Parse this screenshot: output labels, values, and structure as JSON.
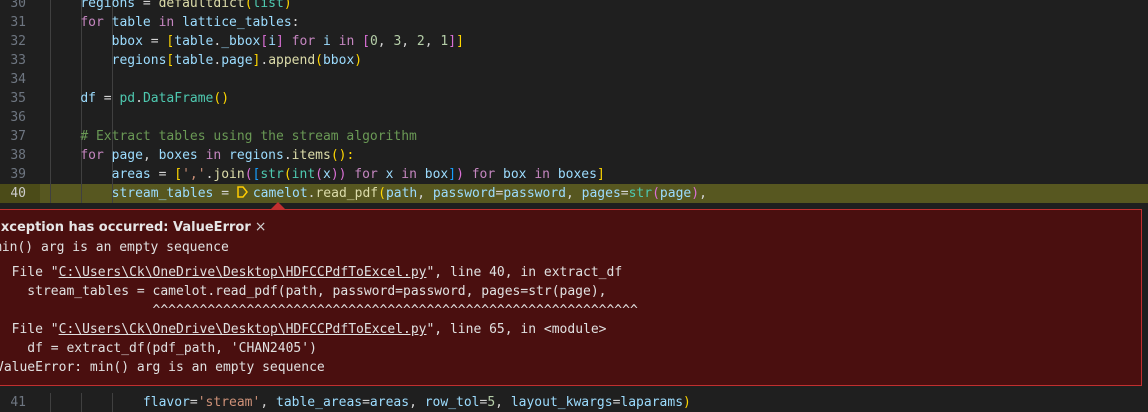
{
  "editor": {
    "lines": [
      {
        "num": "30",
        "segments": [
          {
            "t": "    "
          },
          {
            "t": "regions",
            "c": "var"
          },
          {
            "t": " = "
          },
          {
            "t": "defaultdict",
            "c": "fn"
          },
          {
            "t": "(",
            "c": "br1"
          },
          {
            "t": "list",
            "c": "cls"
          },
          {
            "t": ")",
            "c": "br1"
          }
        ]
      },
      {
        "num": "31",
        "segments": [
          {
            "t": "    "
          },
          {
            "t": "for",
            "c": "kw"
          },
          {
            "t": " "
          },
          {
            "t": "table",
            "c": "var"
          },
          {
            "t": " "
          },
          {
            "t": "in",
            "c": "kw"
          },
          {
            "t": " "
          },
          {
            "t": "lattice_tables",
            "c": "var"
          },
          {
            "t": ":"
          }
        ]
      },
      {
        "num": "32",
        "segments": [
          {
            "t": "        "
          },
          {
            "t": "bbox",
            "c": "var"
          },
          {
            "t": " = "
          },
          {
            "t": "[",
            "c": "br1"
          },
          {
            "t": "table",
            "c": "var"
          },
          {
            "t": "."
          },
          {
            "t": "_bbox",
            "c": "var"
          },
          {
            "t": "[",
            "c": "br2"
          },
          {
            "t": "i",
            "c": "var"
          },
          {
            "t": "]",
            "c": "br2"
          },
          {
            "t": " "
          },
          {
            "t": "for",
            "c": "kw"
          },
          {
            "t": " "
          },
          {
            "t": "i",
            "c": "var"
          },
          {
            "t": " "
          },
          {
            "t": "in",
            "c": "kw"
          },
          {
            "t": " "
          },
          {
            "t": "[",
            "c": "br2"
          },
          {
            "t": "0",
            "c": "num"
          },
          {
            "t": ", "
          },
          {
            "t": "3",
            "c": "num"
          },
          {
            "t": ", "
          },
          {
            "t": "2",
            "c": "num"
          },
          {
            "t": ", "
          },
          {
            "t": "1",
            "c": "num"
          },
          {
            "t": "]",
            "c": "br2"
          },
          {
            "t": "]",
            "c": "br1"
          }
        ]
      },
      {
        "num": "33",
        "segments": [
          {
            "t": "        "
          },
          {
            "t": "regions",
            "c": "var"
          },
          {
            "t": "[",
            "c": "br1"
          },
          {
            "t": "table",
            "c": "var"
          },
          {
            "t": "."
          },
          {
            "t": "page",
            "c": "var"
          },
          {
            "t": "]",
            "c": "br1"
          },
          {
            "t": "."
          },
          {
            "t": "append",
            "c": "fn"
          },
          {
            "t": "(",
            "c": "br1"
          },
          {
            "t": "bbox",
            "c": "var"
          },
          {
            "t": ")",
            "c": "br1"
          }
        ]
      },
      {
        "num": "34",
        "segments": []
      },
      {
        "num": "35",
        "segments": [
          {
            "t": "    "
          },
          {
            "t": "df",
            "c": "var"
          },
          {
            "t": " = "
          },
          {
            "t": "pd",
            "c": "cls"
          },
          {
            "t": "."
          },
          {
            "t": "DataFrame",
            "c": "cls"
          },
          {
            "t": "()",
            "c": "br1"
          }
        ]
      },
      {
        "num": "36",
        "segments": []
      },
      {
        "num": "37",
        "segments": [
          {
            "t": "    "
          },
          {
            "t": "# Extract tables using the stream algorithm",
            "c": "cmt"
          }
        ]
      },
      {
        "num": "38",
        "segments": [
          {
            "t": "    "
          },
          {
            "t": "for",
            "c": "kw"
          },
          {
            "t": " "
          },
          {
            "t": "page",
            "c": "var"
          },
          {
            "t": ", "
          },
          {
            "t": "boxes",
            "c": "var"
          },
          {
            "t": " "
          },
          {
            "t": "in",
            "c": "kw"
          },
          {
            "t": " "
          },
          {
            "t": "regions",
            "c": "var"
          },
          {
            "t": "."
          },
          {
            "t": "items",
            "c": "fn"
          },
          {
            "t": "():",
            "c": "br1"
          }
        ]
      },
      {
        "num": "39",
        "segments": [
          {
            "t": "        "
          },
          {
            "t": "areas",
            "c": "var"
          },
          {
            "t": " = "
          },
          {
            "t": "[",
            "c": "br1"
          },
          {
            "t": "','",
            "c": "str"
          },
          {
            "t": "."
          },
          {
            "t": "join",
            "c": "fn"
          },
          {
            "t": "(",
            "c": "br2"
          },
          {
            "t": "[",
            "c": "br3"
          },
          {
            "t": "str",
            "c": "cls"
          },
          {
            "t": "(",
            "c": "br1"
          },
          {
            "t": "int",
            "c": "cls"
          },
          {
            "t": "(",
            "c": "br2"
          },
          {
            "t": "x",
            "c": "var"
          },
          {
            "t": "))",
            "c": "br2"
          },
          {
            "t": " "
          },
          {
            "t": "for",
            "c": "kw"
          },
          {
            "t": " "
          },
          {
            "t": "x",
            "c": "var"
          },
          {
            "t": " "
          },
          {
            "t": "in",
            "c": "kw"
          },
          {
            "t": " "
          },
          {
            "t": "box",
            "c": "var"
          },
          {
            "t": "]",
            "c": "br3"
          },
          {
            "t": ")",
            "c": "br2"
          },
          {
            "t": " "
          },
          {
            "t": "for",
            "c": "kw"
          },
          {
            "t": " "
          },
          {
            "t": "box",
            "c": "var"
          },
          {
            "t": " "
          },
          {
            "t": "in",
            "c": "kw"
          },
          {
            "t": " "
          },
          {
            "t": "boxes",
            "c": "var"
          },
          {
            "t": "]",
            "c": "br1"
          }
        ]
      },
      {
        "num": "40",
        "current": true,
        "segments": [
          {
            "t": "        "
          },
          {
            "t": "stream_tables",
            "c": "var"
          },
          {
            "t": " = "
          },
          {
            "bp": true
          },
          {
            "t": "camelot",
            "c": "var"
          },
          {
            "t": "."
          },
          {
            "t": "read_pdf",
            "c": "fn"
          },
          {
            "t": "(",
            "c": "br1"
          },
          {
            "t": "path",
            "c": "var"
          },
          {
            "t": ", "
          },
          {
            "t": "password",
            "c": "var"
          },
          {
            "t": "="
          },
          {
            "t": "password",
            "c": "var"
          },
          {
            "t": ", "
          },
          {
            "t": "pages",
            "c": "var"
          },
          {
            "t": "="
          },
          {
            "t": "str",
            "c": "cls"
          },
          {
            "t": "(",
            "c": "br2"
          },
          {
            "t": "page",
            "c": "var"
          },
          {
            "t": ")",
            "c": "br2"
          },
          {
            "t": ","
          }
        ]
      },
      {
        "num": "41",
        "segments": [
          {
            "t": "            "
          },
          {
            "t": "flavor",
            "c": "var"
          },
          {
            "t": "="
          },
          {
            "t": "'stream'",
            "c": "str"
          },
          {
            "t": ", "
          },
          {
            "t": "table_areas",
            "c": "var"
          },
          {
            "t": "="
          },
          {
            "t": "areas",
            "c": "var"
          },
          {
            "t": ", "
          },
          {
            "t": "row_tol",
            "c": "var"
          },
          {
            "t": "="
          },
          {
            "t": "5",
            "c": "num"
          },
          {
            "t": ", "
          },
          {
            "t": "layout_kwargs",
            "c": "var"
          },
          {
            "t": "="
          },
          {
            "t": "laparams",
            "c": "var"
          },
          {
            "t": ")",
            "c": "br1"
          }
        ]
      }
    ]
  },
  "exception": {
    "title": "Exception has occurred: ValueError",
    "close_icon": "×",
    "message": "min() arg is an empty sequence",
    "trace": [
      {
        "pre": "  File \"",
        "link": "C:\\Users\\Ck\\OneDrive\\Desktop\\HDFCCPdfToExcel.py",
        "post": "\", line 40, in extract_df"
      },
      {
        "pre": "    stream_tables = camelot.read_pdf(path, password=password, pages=str(page),"
      },
      {
        "pre": "                    ^^^^^^^^^^^^^^^^^^^^^^^^^^^^^^^^^^^^^^^^^^^^^^^^^^^^^^^^^^^^^^"
      },
      {
        "pre": "  File \"",
        "link": "C:\\Users\\Ck\\OneDrive\\Desktop\\HDFCCPdfToExcel.py",
        "post": "\", line 65, in <module>"
      },
      {
        "pre": "    df = extract_df(pdf_path, 'CHAN2405')"
      },
      {
        "pre": "ValueError: min() arg is an empty sequence"
      }
    ]
  },
  "colors": {
    "editor_bg": "#1f1f1f",
    "current_line_bg": "#4b4b18",
    "exception_bg": "#4a0f0f",
    "exception_border": "#c12f2f"
  }
}
